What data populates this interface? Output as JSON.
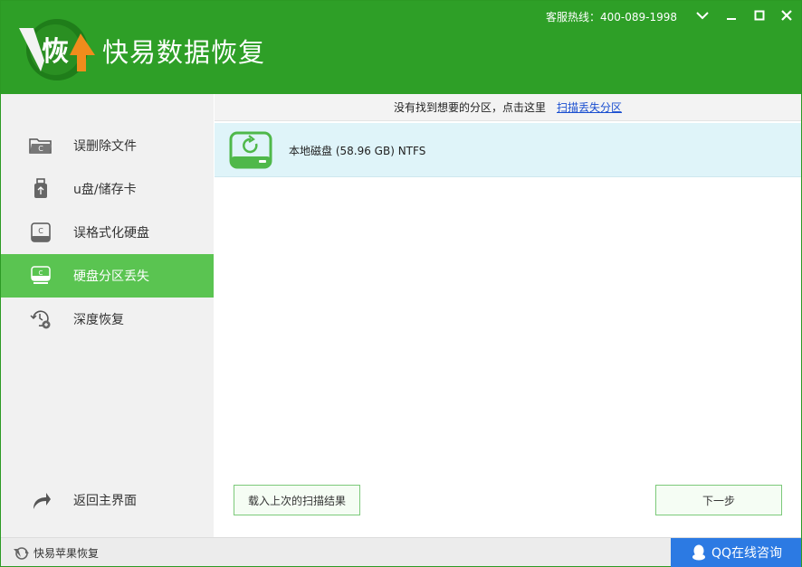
{
  "app": {
    "logo_char": "恢",
    "title": "快易数据恢复",
    "hotline": "客服热线：400-089-1998"
  },
  "sidebar": {
    "items": [
      {
        "label": "误删除文件",
        "icon": "folder-c-icon",
        "active": false
      },
      {
        "label": "u盘/储存卡",
        "icon": "usb-icon",
        "active": false
      },
      {
        "label": "误格式化硬盘",
        "icon": "harddisk-icon",
        "active": false
      },
      {
        "label": "硬盘分区丢失",
        "icon": "partition-icon",
        "active": true
      },
      {
        "label": "深度恢复",
        "icon": "deep-recovery-icon",
        "active": false
      }
    ],
    "back_label": "返回主界面"
  },
  "notice": {
    "text": "没有找到想要的分区，点击这里",
    "link": "扫描丢失分区"
  },
  "disks": [
    {
      "label": "本地磁盘 (58.96 GB) NTFS"
    }
  ],
  "buttons": {
    "load_last": "载入上次的扫描结果",
    "next": "下一步"
  },
  "footer": {
    "apple_link": "快易苹果恢复",
    "qq": "QQ在线咨询"
  },
  "colors": {
    "header_green": "#2e9f27",
    "active_green": "#5ac451",
    "qq_blue": "#2c7ae3"
  }
}
